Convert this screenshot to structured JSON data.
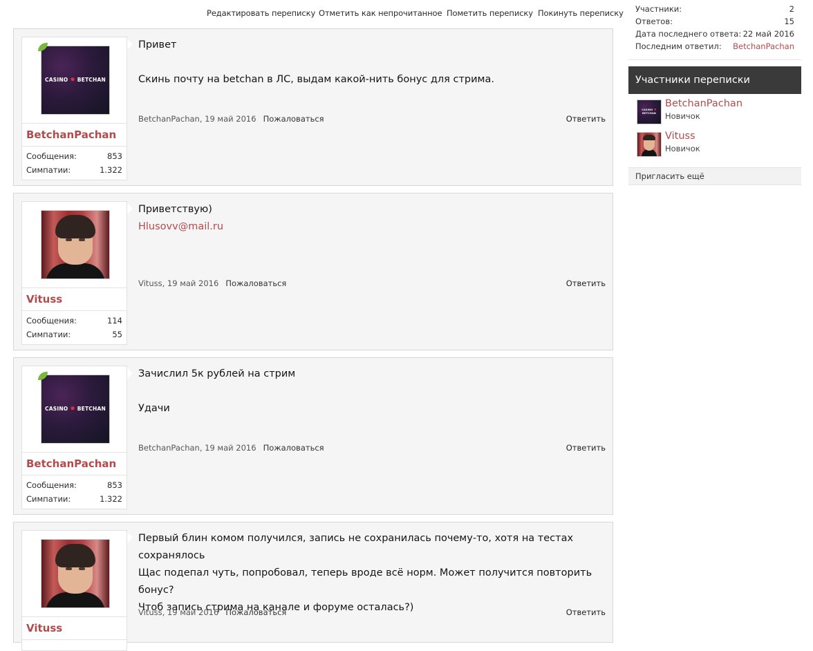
{
  "top_links": [
    "Редактировать переписку",
    "Отметить как непрочитанное",
    "Пометить переписку",
    "Покинуть переписку"
  ],
  "logo": {
    "left": "CASINO",
    "chip": "✹",
    "right": "BETCHAN"
  },
  "labels": {
    "messages": "Сообщения:",
    "likes": "Симпатии:",
    "complain": "Пожаловаться",
    "reply": "Ответить"
  },
  "messages": [
    {
      "username": "BetchanPachan",
      "msg_count": "853",
      "likes": "1.322",
      "author_date": "BetchanPachan, 19 май 2016",
      "line1": "Привет",
      "line2": "Скинь почту на betchan в ЛС, выдам какой-нить бонус для стрима."
    },
    {
      "username": "Vituss",
      "msg_count": "114",
      "likes": "55",
      "author_date": "Vituss, 19 май 2016",
      "line1": "Приветствую)",
      "email": "Hlusovv@mail.ru"
    },
    {
      "username": "BetchanPachan",
      "msg_count": "853",
      "likes": "1.322",
      "author_date": "BetchanPachan, 19 май 2016",
      "line1": "Зачислил 5к рублей на стрим",
      "line2": "Удачи"
    },
    {
      "username": "Vituss",
      "author_date": "Vituss, 19 май 2016",
      "line1": "Первый блин комом получился, запись не сохранилась почему-то, хотя на тестах",
      "line2": "сохранялось",
      "line3": "Щас подепал чуть, попробовал, теперь вроде всё норм. Может получится повторить бонус?",
      "line4": "Чтоб запись стрима на канале и форуме осталась?)"
    }
  ],
  "sidebar": {
    "stats": [
      {
        "label": "Участники:",
        "value": "2"
      },
      {
        "label": "Ответов:",
        "value": "15"
      },
      {
        "label": "Дата последнего ответа:",
        "value": "22 май 2016"
      },
      {
        "label": "Последним ответил:",
        "value": "BetchanPachan"
      }
    ],
    "header": "Участники переписки",
    "members": [
      {
        "name": "BetchanPachan",
        "title": "Новичок"
      },
      {
        "name": "Vituss",
        "title": "Новичок"
      }
    ],
    "invite": "Пригласить ещё"
  },
  "colors": {
    "accent": "#b24b4b",
    "header_bg": "#3a3a3a",
    "message_bg": "#f5f5f5"
  }
}
